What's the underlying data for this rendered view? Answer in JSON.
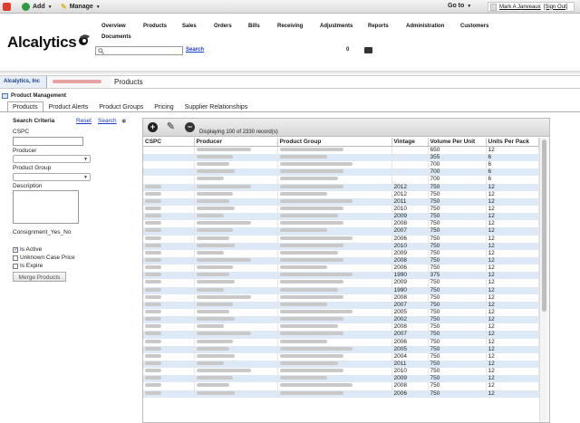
{
  "topbar": {
    "add_label": "Add",
    "manage_label": "Manage",
    "goto_label": "Go to",
    "user_name": "Mark A Janveaux",
    "sign_out": "[Sign Out]",
    "colors": {
      "home": "#e23a2c",
      "add": "#2e9b3d",
      "manage": "#e6b422"
    }
  },
  "header": {
    "logo": "Alcalytics",
    "nav": [
      "Overview",
      "Products",
      "Sales",
      "Orders",
      "Bills",
      "Receiving",
      "Adjustments",
      "Reports",
      "Administration",
      "Customers",
      "Documents"
    ],
    "search_value": "",
    "search_link": "Search",
    "count": "0"
  },
  "breadcrumb": {
    "company": "Alcalytics, Inc",
    "current": "Products"
  },
  "product_management": {
    "title": "Product Management",
    "tabs": [
      "Products",
      "Product Alerts",
      "Product Groups",
      "Pricing",
      "Supplier Relationships"
    ]
  },
  "search_criteria": {
    "title": "Search Criteria",
    "reset": "Reset",
    "search": "Search",
    "cspc_label": "CSPC",
    "producer_label": "Producer",
    "product_group_label": "Product Group",
    "description_label": "Description",
    "consignment_label": "Consignment_Yes_No",
    "is_active": "Is Active",
    "unknown_case_price": "Unknown Case Price",
    "is_expire": "Is Expire",
    "merge_button": "Merge Products"
  },
  "grid": {
    "display_text": "Displaying 100 of 2330 record(s)",
    "columns": [
      "CSPC",
      "Producer",
      "Product Group",
      "Vintage",
      "Volume Per Unit",
      "Units Per Pack"
    ],
    "rows": [
      {
        "vintage": "",
        "volume": "650",
        "units": "12"
      },
      {
        "vintage": "",
        "volume": "355",
        "units": "6"
      },
      {
        "vintage": "",
        "volume": "700",
        "units": "6"
      },
      {
        "vintage": "",
        "volume": "700",
        "units": "6"
      },
      {
        "vintage": "",
        "volume": "700",
        "units": "6"
      },
      {
        "vintage": "2012",
        "volume": "750",
        "units": "12"
      },
      {
        "vintage": "2012",
        "volume": "750",
        "units": "12"
      },
      {
        "vintage": "2011",
        "volume": "750",
        "units": "12"
      },
      {
        "vintage": "2010",
        "volume": "750",
        "units": "12"
      },
      {
        "vintage": "2009",
        "volume": "750",
        "units": "12"
      },
      {
        "vintage": "2008",
        "volume": "750",
        "units": "12"
      },
      {
        "vintage": "2007",
        "volume": "750",
        "units": "12"
      },
      {
        "vintage": "2006",
        "volume": "750",
        "units": "12"
      },
      {
        "vintage": "2010",
        "volume": "750",
        "units": "12"
      },
      {
        "vintage": "2009",
        "volume": "750",
        "units": "12"
      },
      {
        "vintage": "2008",
        "volume": "750",
        "units": "12"
      },
      {
        "vintage": "2006",
        "volume": "750",
        "units": "12"
      },
      {
        "vintage": "1990",
        "volume": "375",
        "units": "12"
      },
      {
        "vintage": "2009",
        "volume": "750",
        "units": "12"
      },
      {
        "vintage": "1990",
        "volume": "750",
        "units": "12"
      },
      {
        "vintage": "2008",
        "volume": "750",
        "units": "12"
      },
      {
        "vintage": "2007",
        "volume": "750",
        "units": "12"
      },
      {
        "vintage": "2005",
        "volume": "750",
        "units": "12"
      },
      {
        "vintage": "2002",
        "volume": "750",
        "units": "12"
      },
      {
        "vintage": "2008",
        "volume": "750",
        "units": "12"
      },
      {
        "vintage": "2007",
        "volume": "750",
        "units": "12"
      },
      {
        "vintage": "2006",
        "volume": "750",
        "units": "12"
      },
      {
        "vintage": "2005",
        "volume": "750",
        "units": "12"
      },
      {
        "vintage": "2004",
        "volume": "750",
        "units": "12"
      },
      {
        "vintage": "2011",
        "volume": "750",
        "units": "12"
      },
      {
        "vintage": "2010",
        "volume": "750",
        "units": "12"
      },
      {
        "vintage": "2009",
        "volume": "750",
        "units": "12"
      },
      {
        "vintage": "2008",
        "volume": "750",
        "units": "12"
      },
      {
        "vintage": "2006",
        "volume": "750",
        "units": "12"
      }
    ]
  }
}
